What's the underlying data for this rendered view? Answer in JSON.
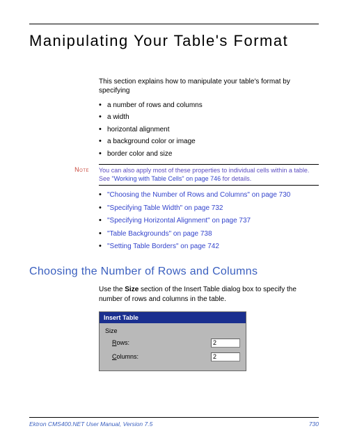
{
  "title": "Manipulating Your Table's Format",
  "intro": "This section explains how to manipulate your table's format by specifying",
  "specifying_items": [
    "a number of rows and columns",
    "a width",
    "horizontal alignment",
    "a background color or image",
    "border color and size"
  ],
  "note": {
    "label": "Note",
    "part1": "You can also apply most of these properties to individual cells within a table. See ",
    "link": "\"Working with Table Cells\" on page 746",
    "part2": " for details."
  },
  "links": [
    "\"Choosing the Number of Rows and Columns\" on page 730",
    "\"Specifying Table Width\" on page 732",
    "\"Specifying Horizontal Alignment\" on page 737",
    "\"Table Backgrounds\" on page 738",
    "\"Setting Table Borders\" on page 742"
  ],
  "section_heading": "Choosing the Number of Rows and Columns",
  "section_para_pre": "Use the ",
  "section_para_bold": "Size",
  "section_para_post": " section of the Insert Table dialog box to specify the number of rows and columns in the table.",
  "dialog": {
    "title": "Insert Table",
    "group": "Size",
    "rows_underline": "R",
    "rows_rest": "ows:",
    "cols_underline": "C",
    "cols_rest": "olumns:",
    "rows_value": "2",
    "cols_value": "2"
  },
  "footer_left": "Ektron CMS400.NET User Manual, Version 7.5",
  "footer_right": "730"
}
